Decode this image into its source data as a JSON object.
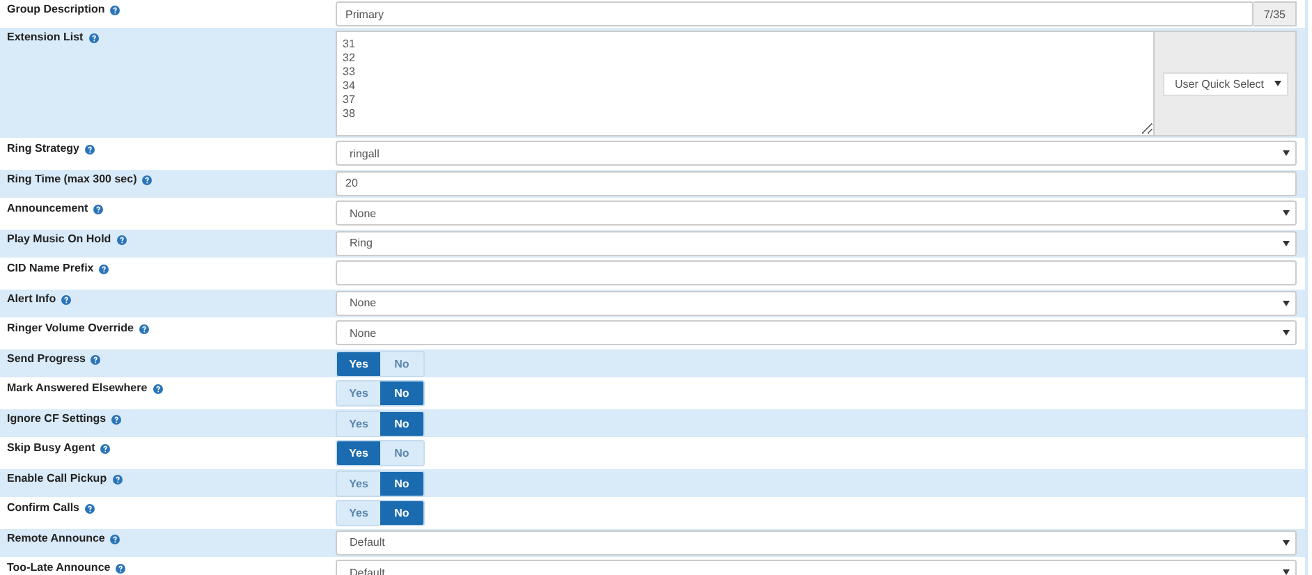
{
  "rows": [
    {
      "kind": "text",
      "label": "Group Description",
      "value": "Primary",
      "counter": "7/35"
    },
    {
      "kind": "textarea",
      "label": "Extension List",
      "value": "31\n32\n33\n34\n37\n38",
      "quick_select": "User Quick Select"
    },
    {
      "kind": "select",
      "label": "Ring Strategy",
      "value": "ringall"
    },
    {
      "kind": "text",
      "label": "Ring Time (max 300 sec)",
      "value": "20"
    },
    {
      "kind": "select",
      "label": "Announcement",
      "value": "None"
    },
    {
      "kind": "select",
      "label": "Play Music On Hold",
      "value": "Ring"
    },
    {
      "kind": "text",
      "label": "CID Name Prefix",
      "value": ""
    },
    {
      "kind": "select",
      "label": "Alert Info",
      "value": "None"
    },
    {
      "kind": "select",
      "label": "Ringer Volume Override",
      "value": "None"
    },
    {
      "kind": "toggle",
      "label": "Send Progress",
      "options": [
        {
          "label": "Yes",
          "selected": true
        },
        {
          "label": "No",
          "selected": false
        }
      ]
    },
    {
      "kind": "toggle",
      "label": "Mark Answered Elsewhere",
      "options": [
        {
          "label": "Yes",
          "selected": false
        },
        {
          "label": "No",
          "selected": true
        }
      ]
    },
    {
      "kind": "toggle",
      "label": "Ignore CF Settings",
      "options": [
        {
          "label": "Yes",
          "selected": false
        },
        {
          "label": "No",
          "selected": true
        }
      ]
    },
    {
      "kind": "toggle",
      "label": "Skip Busy Agent",
      "options": [
        {
          "label": "Yes",
          "selected": true
        },
        {
          "label": "No",
          "selected": false
        }
      ]
    },
    {
      "kind": "toggle",
      "label": "Enable Call Pickup",
      "options": [
        {
          "label": "Yes",
          "selected": false
        },
        {
          "label": "No",
          "selected": true
        }
      ]
    },
    {
      "kind": "toggle",
      "label": "Confirm Calls",
      "options": [
        {
          "label": "Yes",
          "selected": false
        },
        {
          "label": "No",
          "selected": true
        }
      ]
    },
    {
      "kind": "select",
      "label": "Remote Announce",
      "value": "Default"
    },
    {
      "kind": "select",
      "label": "Too-Late Announce",
      "value": "Default"
    }
  ]
}
